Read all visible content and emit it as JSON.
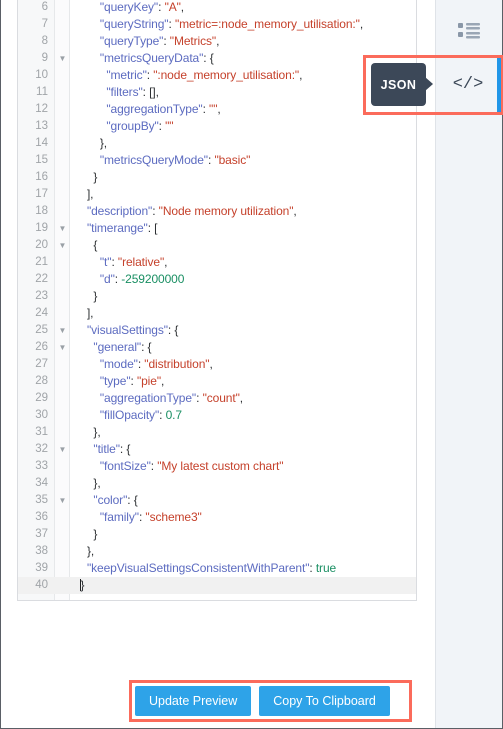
{
  "editor": {
    "language": "json",
    "first_line_number": 6,
    "active_line": 40,
    "lines": [
      {
        "n": 6,
        "fold": false,
        "indent": 4,
        "tokens": [
          {
            "t": "k",
            "v": "\"queryKey\""
          },
          {
            "t": "p",
            "v": ": "
          },
          {
            "t": "s",
            "v": "\"A\""
          },
          {
            "t": "p",
            "v": ","
          }
        ]
      },
      {
        "n": 7,
        "fold": false,
        "indent": 4,
        "tokens": [
          {
            "t": "k",
            "v": "\"queryString\""
          },
          {
            "t": "p",
            "v": ": "
          },
          {
            "t": "s",
            "v": "\"metric=:node_memory_utilisation:\""
          },
          {
            "t": "p",
            "v": ","
          }
        ]
      },
      {
        "n": 8,
        "fold": false,
        "indent": 4,
        "tokens": [
          {
            "t": "k",
            "v": "\"queryType\""
          },
          {
            "t": "p",
            "v": ": "
          },
          {
            "t": "s",
            "v": "\"Metrics\""
          },
          {
            "t": "p",
            "v": ","
          }
        ]
      },
      {
        "n": 9,
        "fold": true,
        "indent": 4,
        "tokens": [
          {
            "t": "k",
            "v": "\"metricsQueryData\""
          },
          {
            "t": "p",
            "v": ": {"
          }
        ]
      },
      {
        "n": 10,
        "fold": false,
        "indent": 5,
        "tokens": [
          {
            "t": "k",
            "v": "\"metric\""
          },
          {
            "t": "p",
            "v": ": "
          },
          {
            "t": "s",
            "v": "\":node_memory_utilisation:\""
          },
          {
            "t": "p",
            "v": ","
          }
        ]
      },
      {
        "n": 11,
        "fold": false,
        "indent": 5,
        "tokens": [
          {
            "t": "k",
            "v": "\"filters\""
          },
          {
            "t": "p",
            "v": ": []"
          },
          {
            "t": "p",
            "v": ","
          }
        ]
      },
      {
        "n": 12,
        "fold": false,
        "indent": 5,
        "tokens": [
          {
            "t": "k",
            "v": "\"aggregationType\""
          },
          {
            "t": "p",
            "v": ": "
          },
          {
            "t": "s",
            "v": "\"\""
          },
          {
            "t": "p",
            "v": ","
          }
        ]
      },
      {
        "n": 13,
        "fold": false,
        "indent": 5,
        "tokens": [
          {
            "t": "k",
            "v": "\"groupBy\""
          },
          {
            "t": "p",
            "v": ": "
          },
          {
            "t": "s",
            "v": "\"\""
          }
        ]
      },
      {
        "n": 14,
        "fold": false,
        "indent": 4,
        "tokens": [
          {
            "t": "p",
            "v": "},"
          }
        ]
      },
      {
        "n": 15,
        "fold": false,
        "indent": 4,
        "tokens": [
          {
            "t": "k",
            "v": "\"metricsQueryMode\""
          },
          {
            "t": "p",
            "v": ": "
          },
          {
            "t": "s",
            "v": "\"basic\""
          }
        ]
      },
      {
        "n": 16,
        "fold": false,
        "indent": 3,
        "tokens": [
          {
            "t": "p",
            "v": "}"
          }
        ]
      },
      {
        "n": 17,
        "fold": false,
        "indent": 2,
        "tokens": [
          {
            "t": "p",
            "v": "],"
          }
        ]
      },
      {
        "n": 18,
        "fold": false,
        "indent": 2,
        "tokens": [
          {
            "t": "k",
            "v": "\"description\""
          },
          {
            "t": "p",
            "v": ": "
          },
          {
            "t": "s",
            "v": "\"Node memory utilization\""
          },
          {
            "t": "p",
            "v": ","
          }
        ]
      },
      {
        "n": 19,
        "fold": true,
        "indent": 2,
        "tokens": [
          {
            "t": "k",
            "v": "\"timerange\""
          },
          {
            "t": "p",
            "v": ": ["
          }
        ]
      },
      {
        "n": 20,
        "fold": true,
        "indent": 3,
        "tokens": [
          {
            "t": "p",
            "v": "{"
          }
        ]
      },
      {
        "n": 21,
        "fold": false,
        "indent": 4,
        "tokens": [
          {
            "t": "k",
            "v": "\"t\""
          },
          {
            "t": "p",
            "v": ": "
          },
          {
            "t": "s",
            "v": "\"relative\""
          },
          {
            "t": "p",
            "v": ","
          }
        ]
      },
      {
        "n": 22,
        "fold": false,
        "indent": 4,
        "tokens": [
          {
            "t": "k",
            "v": "\"d\""
          },
          {
            "t": "p",
            "v": ": "
          },
          {
            "t": "n",
            "v": "-259200000"
          }
        ]
      },
      {
        "n": 23,
        "fold": false,
        "indent": 3,
        "tokens": [
          {
            "t": "p",
            "v": "}"
          }
        ]
      },
      {
        "n": 24,
        "fold": false,
        "indent": 2,
        "tokens": [
          {
            "t": "p",
            "v": "],"
          }
        ]
      },
      {
        "n": 25,
        "fold": true,
        "indent": 2,
        "tokens": [
          {
            "t": "k",
            "v": "\"visualSettings\""
          },
          {
            "t": "p",
            "v": ": {"
          }
        ]
      },
      {
        "n": 26,
        "fold": true,
        "indent": 3,
        "tokens": [
          {
            "t": "k",
            "v": "\"general\""
          },
          {
            "t": "p",
            "v": ": {"
          }
        ]
      },
      {
        "n": 27,
        "fold": false,
        "indent": 4,
        "tokens": [
          {
            "t": "k",
            "v": "\"mode\""
          },
          {
            "t": "p",
            "v": ": "
          },
          {
            "t": "s",
            "v": "\"distribution\""
          },
          {
            "t": "p",
            "v": ","
          }
        ]
      },
      {
        "n": 28,
        "fold": false,
        "indent": 4,
        "tokens": [
          {
            "t": "k",
            "v": "\"type\""
          },
          {
            "t": "p",
            "v": ": "
          },
          {
            "t": "s",
            "v": "\"pie\""
          },
          {
            "t": "p",
            "v": ","
          }
        ]
      },
      {
        "n": 29,
        "fold": false,
        "indent": 4,
        "tokens": [
          {
            "t": "k",
            "v": "\"aggregationType\""
          },
          {
            "t": "p",
            "v": ": "
          },
          {
            "t": "s",
            "v": "\"count\""
          },
          {
            "t": "p",
            "v": ","
          }
        ]
      },
      {
        "n": 30,
        "fold": false,
        "indent": 4,
        "tokens": [
          {
            "t": "k",
            "v": "\"fillOpacity\""
          },
          {
            "t": "p",
            "v": ": "
          },
          {
            "t": "n",
            "v": "0.7"
          }
        ]
      },
      {
        "n": 31,
        "fold": false,
        "indent": 3,
        "tokens": [
          {
            "t": "p",
            "v": "},"
          }
        ]
      },
      {
        "n": 32,
        "fold": true,
        "indent": 3,
        "tokens": [
          {
            "t": "k",
            "v": "\"title\""
          },
          {
            "t": "p",
            "v": ": {"
          }
        ]
      },
      {
        "n": 33,
        "fold": false,
        "indent": 4,
        "tokens": [
          {
            "t": "k",
            "v": "\"fontSize\""
          },
          {
            "t": "p",
            "v": ": "
          },
          {
            "t": "s",
            "v": "\"My latest custom chart\""
          }
        ]
      },
      {
        "n": 34,
        "fold": false,
        "indent": 3,
        "tokens": [
          {
            "t": "p",
            "v": "},"
          }
        ]
      },
      {
        "n": 35,
        "fold": true,
        "indent": 3,
        "tokens": [
          {
            "t": "k",
            "v": "\"color\""
          },
          {
            "t": "p",
            "v": ": {"
          }
        ]
      },
      {
        "n": 36,
        "fold": false,
        "indent": 4,
        "tokens": [
          {
            "t": "k",
            "v": "\"family\""
          },
          {
            "t": "p",
            "v": ": "
          },
          {
            "t": "s",
            "v": "\"scheme3\""
          }
        ]
      },
      {
        "n": 37,
        "fold": false,
        "indent": 3,
        "tokens": [
          {
            "t": "p",
            "v": "}"
          }
        ]
      },
      {
        "n": 38,
        "fold": false,
        "indent": 2,
        "tokens": [
          {
            "t": "p",
            "v": "},"
          }
        ]
      },
      {
        "n": 39,
        "fold": false,
        "indent": 2,
        "tokens": [
          {
            "t": "k",
            "v": "\"keepVisualSettingsConsistentWithParent\""
          },
          {
            "t": "p",
            "v": ": "
          },
          {
            "t": "b",
            "v": "true"
          }
        ]
      },
      {
        "n": 40,
        "fold": false,
        "indent": 1,
        "tokens": [
          {
            "t": "p",
            "v": "}"
          }
        ],
        "caret": true
      }
    ]
  },
  "tooltip": {
    "label": "JSON"
  },
  "code_toggle": {
    "glyph": "</>",
    "icon": "code-icon"
  },
  "right_rail": {
    "form_icon": "form-list-icon",
    "active_accent": "#2196e8"
  },
  "buttons": {
    "update_preview": "Update Preview",
    "copy_to_clipboard": "Copy To Clipboard",
    "accent": "#2ea3e8"
  },
  "annotations": {
    "highlight_color": "#fb6b5b",
    "json_toggle_label": "JSON",
    "buttons_label": "Update Preview / Copy To Clipboard"
  }
}
